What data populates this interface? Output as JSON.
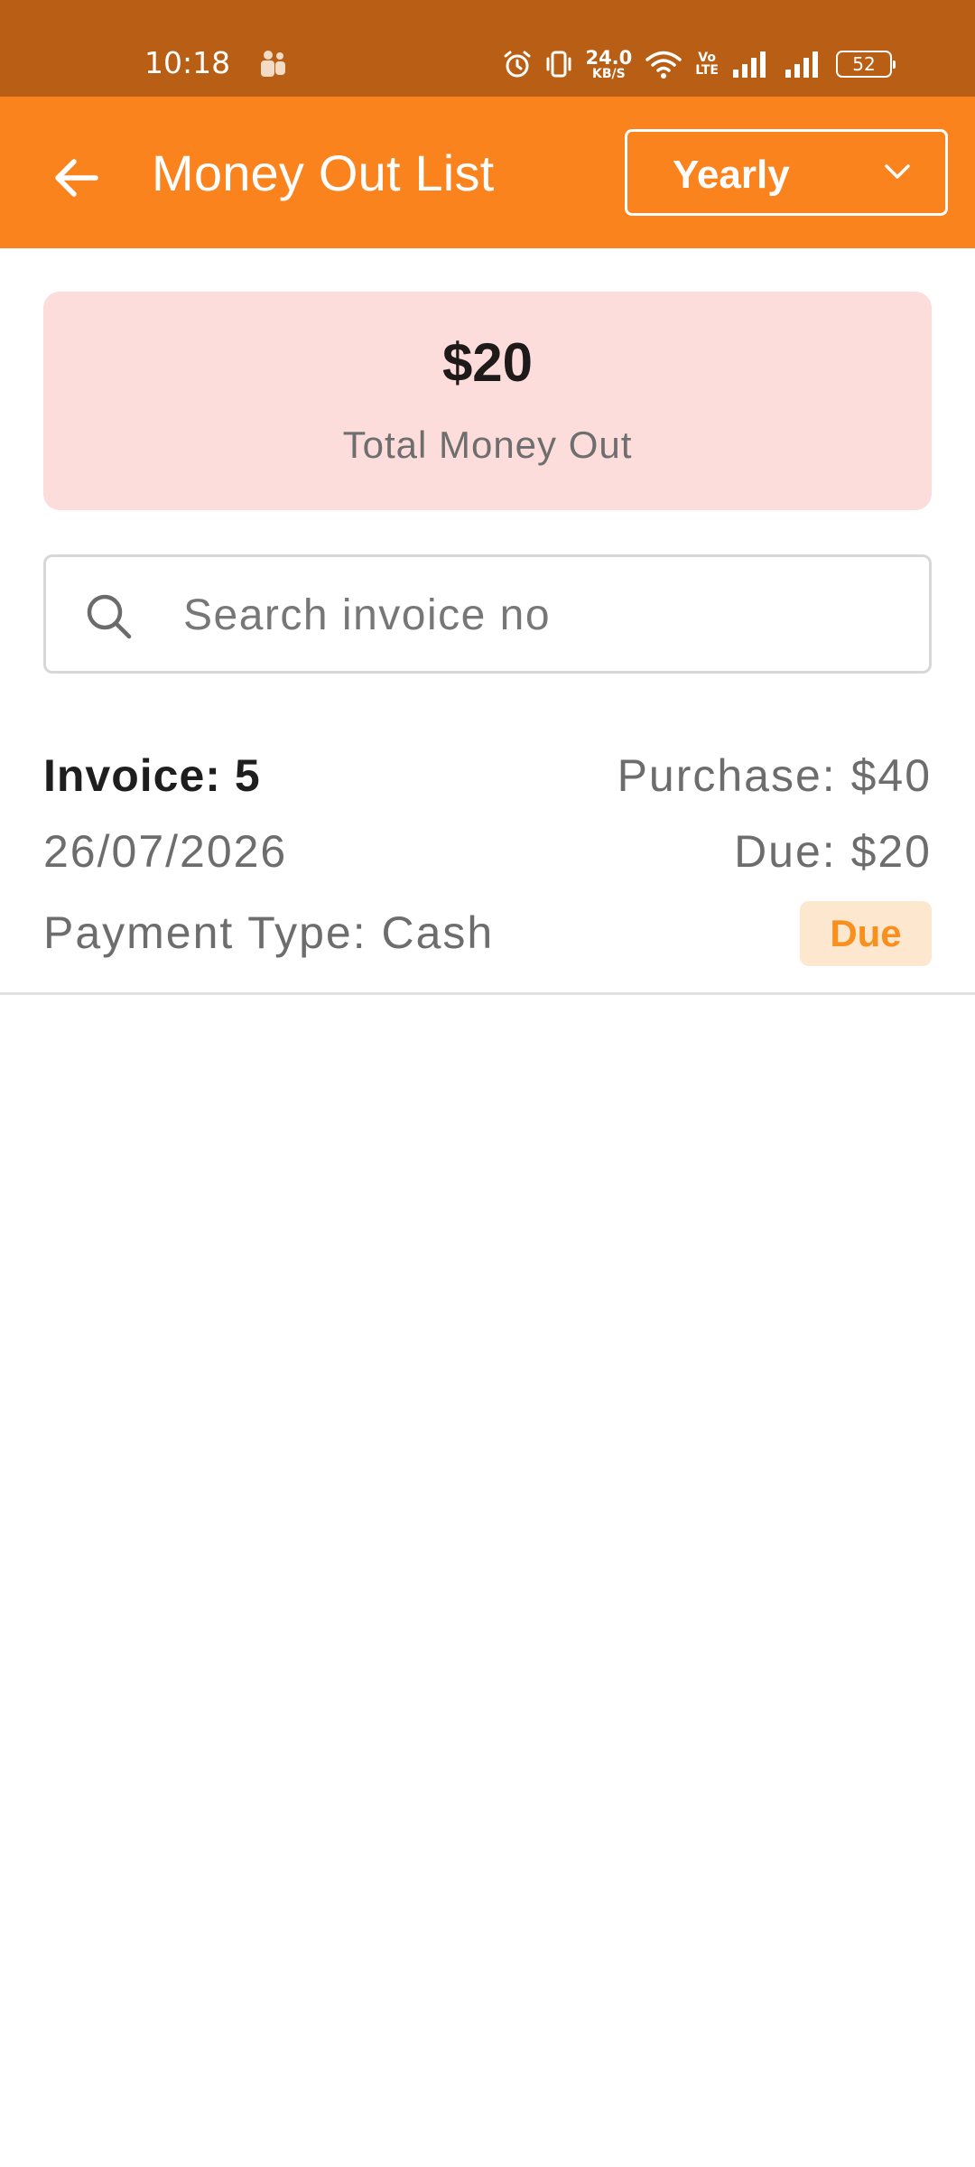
{
  "status_bar": {
    "time": "10:18",
    "net_speed_value": "24.0",
    "net_speed_unit": "KB/S",
    "volte_top": "Vo",
    "volte_bottom": "LTE",
    "battery": "52",
    "icons": [
      "teams-icon",
      "alarm-icon",
      "vibrate-icon",
      "wifi-icon",
      "volte-icon",
      "signal-icon",
      "signal-icon",
      "battery-icon"
    ]
  },
  "app_bar": {
    "title": "Money Out List",
    "back_icon": "back-arrow-icon",
    "period": {
      "selected": "Yearly",
      "icon": "chevron-down-icon"
    }
  },
  "summary": {
    "amount": "$20",
    "label": "Total Money Out"
  },
  "search": {
    "placeholder": "Search invoice no",
    "value": "",
    "icon": "search-icon"
  },
  "invoices": [
    {
      "title": "Invoice: 5",
      "date": "26/07/2026",
      "payment_type": "Payment Type: Cash",
      "purchase": "Purchase: $40",
      "due": "Due: $20",
      "status": "Due"
    }
  ],
  "colors": {
    "status_bar": "#B85F15",
    "app_bar": "#FB831E",
    "summary_bg": "#FDDCDC",
    "badge_bg": "#FDE7CE",
    "badge_text": "#F7901E"
  }
}
